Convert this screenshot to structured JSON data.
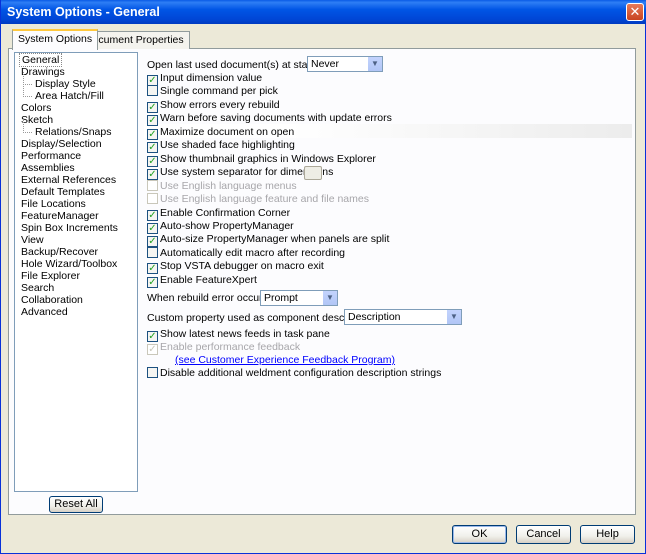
{
  "window": {
    "title": "System Options - General"
  },
  "tabs": [
    {
      "label": "System Options",
      "active": true
    },
    {
      "label": "Document Properties",
      "active": false
    }
  ],
  "tree": [
    {
      "label": "General",
      "level": 0,
      "selected": true
    },
    {
      "label": "Drawings",
      "level": 0
    },
    {
      "label": "Display Style",
      "level": 1
    },
    {
      "label": "Area Hatch/Fill",
      "level": 1
    },
    {
      "label": "Colors",
      "level": 0
    },
    {
      "label": "Sketch",
      "level": 0
    },
    {
      "label": "Relations/Snaps",
      "level": 1
    },
    {
      "label": "Display/Selection",
      "level": 0
    },
    {
      "label": "Performance",
      "level": 0
    },
    {
      "label": "Assemblies",
      "level": 0
    },
    {
      "label": "External References",
      "level": 0
    },
    {
      "label": "Default Templates",
      "level": 0
    },
    {
      "label": "File Locations",
      "level": 0
    },
    {
      "label": "FeatureManager",
      "level": 0
    },
    {
      "label": "Spin Box Increments",
      "level": 0
    },
    {
      "label": "View",
      "level": 0
    },
    {
      "label": "Backup/Recover",
      "level": 0
    },
    {
      "label": "Hole Wizard/Toolbox",
      "level": 0
    },
    {
      "label": "File Explorer",
      "level": 0
    },
    {
      "label": "Search",
      "level": 0
    },
    {
      "label": "Collaboration",
      "level": 0
    },
    {
      "label": "Advanced",
      "level": 0
    }
  ],
  "startup": {
    "label": "Open last used document(s) at startup:",
    "value": "Never"
  },
  "options_a": [
    {
      "label": "Input dimension value",
      "checked": true,
      "disabled": false
    },
    {
      "label": "Single command per pick",
      "checked": false,
      "disabled": false
    },
    {
      "label": "Show errors every rebuild",
      "checked": true,
      "disabled": false
    },
    {
      "label": "Warn before saving documents with update errors",
      "checked": true,
      "disabled": false
    },
    {
      "label": "Maximize document on open",
      "checked": true,
      "disabled": false
    },
    {
      "label": "Use shaded face highlighting",
      "checked": true,
      "disabled": false
    },
    {
      "label": "Show thumbnail graphics in Windows Explorer",
      "checked": true,
      "disabled": false
    },
    {
      "label": "Use system separator for dimensions",
      "checked": true,
      "disabled": false
    },
    {
      "label": "Use English language menus",
      "checked": false,
      "disabled": true
    },
    {
      "label": "Use English language feature and file names",
      "checked": false,
      "disabled": true
    },
    {
      "label": "Enable Confirmation Corner",
      "checked": true,
      "disabled": false
    },
    {
      "label": "Auto-show PropertyManager",
      "checked": true,
      "disabled": false
    },
    {
      "label": "Auto-size PropertyManager when panels are split",
      "checked": true,
      "disabled": false
    },
    {
      "label": "Automatically edit macro after recording",
      "checked": false,
      "disabled": false
    },
    {
      "label": "Stop VSTA debugger on macro exit",
      "checked": true,
      "disabled": false
    },
    {
      "label": "Enable FeatureXpert",
      "checked": true,
      "disabled": false
    }
  ],
  "rebuild_error": {
    "label": "When rebuild error occurs:",
    "value": "Prompt"
  },
  "custom_property": {
    "label": "Custom property used as component description:",
    "value": "Description"
  },
  "options_b": [
    {
      "label": "Show latest news feeds in task pane",
      "checked": true,
      "disabled": false
    },
    {
      "label": "Enable performance feedback",
      "checked": true,
      "disabled": true
    }
  ],
  "feedback_link": "(see Customer Experience Feedback Program)",
  "weldment_option": {
    "label": "Disable additional weldment configuration description strings",
    "checked": false,
    "disabled": false
  },
  "buttons": {
    "reset_all": "Reset All",
    "ok": "OK",
    "cancel": "Cancel",
    "help": "Help"
  },
  "icons": {
    "close": "close-icon",
    "dropdown": "chevron-down-icon",
    "check": "check-icon"
  },
  "colors": {
    "titlebar": "#0055E5",
    "selected_tab_accent": "#FFC83C",
    "link": "#0000FF",
    "check": "#21A121"
  }
}
